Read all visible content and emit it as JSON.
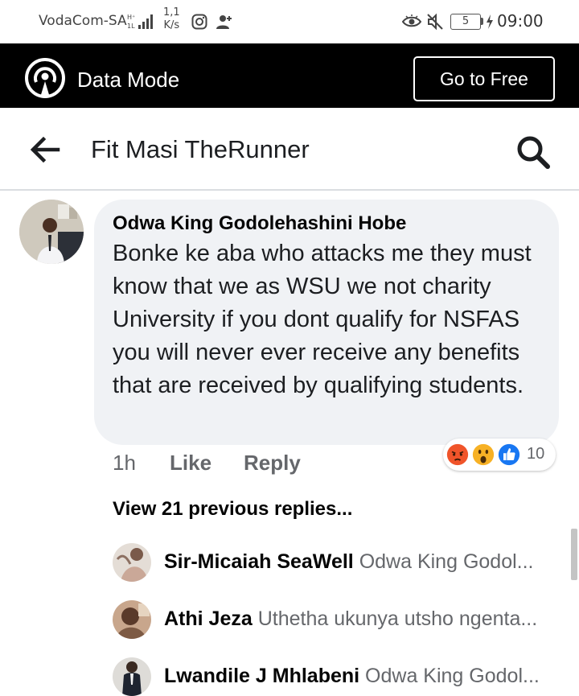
{
  "status_bar": {
    "carrier": "VodaCom-SA",
    "speed_value": "1,1",
    "speed_unit": "K/s",
    "battery": "5",
    "time": "09:00"
  },
  "data_mode": {
    "icon": "broadcast-icon",
    "label": "Data Mode",
    "button_label": "Go to Free"
  },
  "header": {
    "back_icon": "arrow-left-icon",
    "title": "Fit Masi TheRunner",
    "search_icon": "search-icon"
  },
  "comment": {
    "author": "Odwa King Godolehashini Hobe",
    "text": "Bonke ke aba who attacks me they must know that we as WSU we not charity University if you dont qualify for NSFAS you will never ever receive any benefits that are received by qualifying students.",
    "time": "1h",
    "like_label": "Like",
    "reply_label": "Reply",
    "reactions": [
      "angry",
      "wow",
      "like"
    ],
    "reaction_count": "10"
  },
  "view_replies": "View 21 previous replies...",
  "replies": [
    {
      "name": "Sir-Micaiah SeaWell",
      "text": "Odwa King Godol..."
    },
    {
      "name": "Athi Jeza",
      "text": "Uthetha ukunya utsho ngenta..."
    },
    {
      "name": "Lwandile J Mhlabeni",
      "text": "Odwa King Godol..."
    }
  ],
  "colors": {
    "data_mode_bg": "#000000",
    "bubble_bg": "#f0f2f5",
    "secondary_text": "#65676b",
    "like_blue": "#1877f2",
    "angry_orange": "#f0542a",
    "wow_yellow": "#f7b125"
  }
}
